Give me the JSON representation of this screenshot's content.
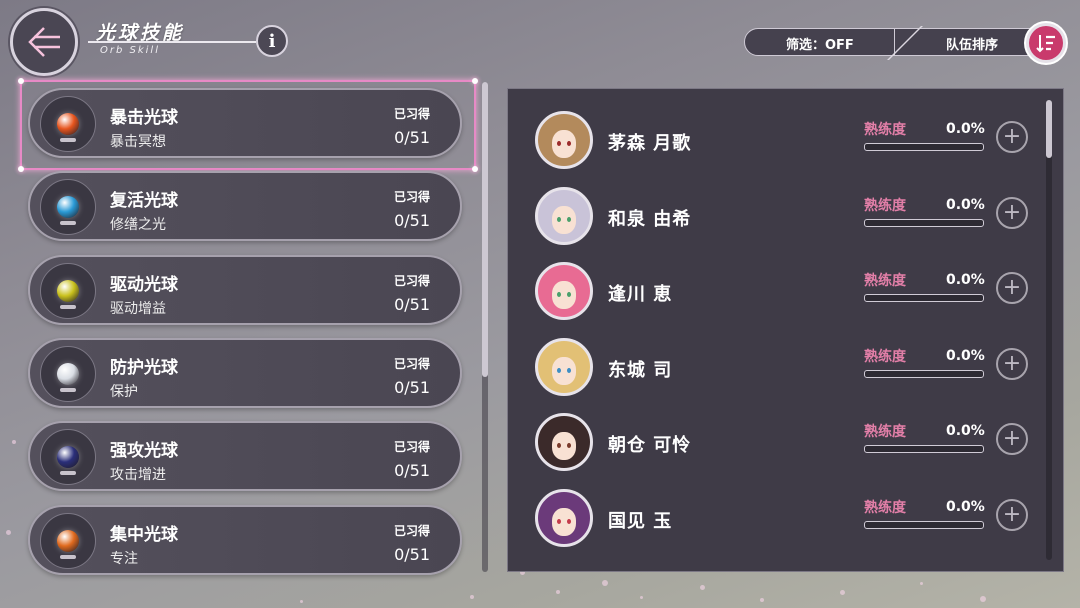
{
  "header": {
    "title_cn": "光球技能",
    "title_en": "Orb Skill",
    "back_icon": "back-arrow-icon",
    "info_icon": "info-icon"
  },
  "filter": {
    "label": "筛选：OFF"
  },
  "sort": {
    "label": "队伍排序",
    "icon": "sort-icon"
  },
  "orbs": [
    {
      "name": "暴击光球",
      "sub": "暴击冥想",
      "learned_label": "已习得",
      "count": "0/51",
      "color": "#e6551e"
    },
    {
      "name": "复活光球",
      "sub": "修缮之光",
      "learned_label": "已习得",
      "count": "0/51",
      "color": "#2a9ad6"
    },
    {
      "name": "驱动光球",
      "sub": "驱动增益",
      "learned_label": "已习得",
      "count": "0/51",
      "color": "#c9c11c"
    },
    {
      "name": "防护光球",
      "sub": "保护",
      "learned_label": "已习得",
      "count": "0/51",
      "color": "#d9dde4"
    },
    {
      "name": "强攻光球",
      "sub": "攻击增进",
      "learned_label": "已习得",
      "count": "0/51",
      "color": "#2b2f7a"
    },
    {
      "name": "集中光球",
      "sub": "专注",
      "learned_label": "已习得",
      "count": "0/51",
      "color": "#e06a1e"
    }
  ],
  "characters": [
    {
      "name": "茅森 月歌",
      "prof_label": "熟练度",
      "prof_value": "0.0%",
      "proficiency": 0,
      "hair": "#b38a5c",
      "eye": "#9c2b2b"
    },
    {
      "name": "和泉 由希",
      "prof_label": "熟练度",
      "prof_value": "0.0%",
      "proficiency": 0,
      "hair": "#c9c3d8",
      "eye": "#4aa06b"
    },
    {
      "name": "逢川 恵",
      "prof_label": "熟练度",
      "prof_value": "0.0%",
      "proficiency": 0,
      "hair": "#e86b93",
      "eye": "#4aa06b"
    },
    {
      "name": "东城 司",
      "prof_label": "熟练度",
      "prof_value": "0.0%",
      "proficiency": 0,
      "hair": "#e2c075",
      "eye": "#3e8ec4"
    },
    {
      "name": "朝仓 可怜",
      "prof_label": "熟练度",
      "prof_value": "0.0%",
      "proficiency": 0,
      "hair": "#3b2a2a",
      "eye": "#7a3b2b"
    },
    {
      "name": "国见 玉",
      "prof_label": "熟练度",
      "prof_value": "0.0%",
      "proficiency": 0,
      "hair": "#6b3a7a",
      "eye": "#c43b4b"
    }
  ],
  "colors": {
    "accent_pink": "#e27fa8",
    "panel": "#3f3b47",
    "sort_button": "#c93a6c"
  }
}
